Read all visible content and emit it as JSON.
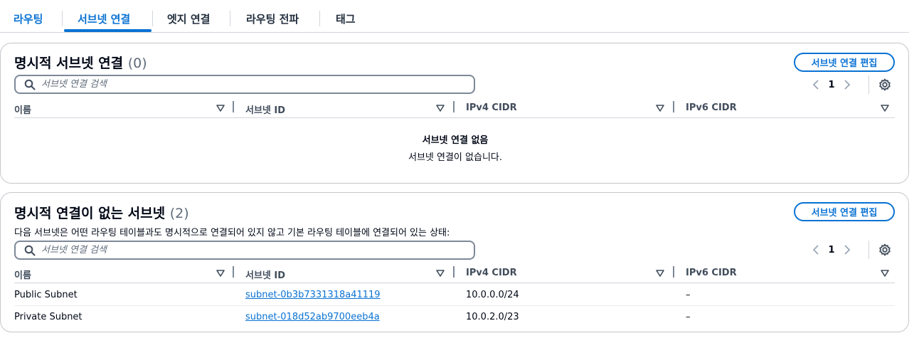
{
  "tabs": {
    "routing": "라우팅",
    "subnet_assoc": "서브넷 연결",
    "edge_assoc": "엣지 연결",
    "route_propagation": "라우팅 전파",
    "tags": "태그"
  },
  "explicit_section": {
    "title": "명시적 서브넷 연결",
    "count": "(0)",
    "edit_button": "서브넷 연결 편집",
    "search_placeholder": "서브넷 연결 검색",
    "page_number": "1",
    "columns": [
      "이름",
      "서브넷 ID",
      "IPv4 CIDR",
      "IPv6 CIDR"
    ],
    "empty_title": "서브넷 연결 없음",
    "empty_text": "서브넷 연결이 없습니다."
  },
  "implicit_section": {
    "title": "명시적 연결이 없는 서브넷",
    "count": "(2)",
    "description": "다음 서브넷은 어떤 라우팅 테이블과도 명시적으로 연결되어 있지 않고 기본 라우팅 테이블에 연결되어 있는 상태:",
    "edit_button": "서브넷 연결 편집",
    "search_placeholder": "서브넷 연결 검색",
    "page_number": "1",
    "columns": [
      "이름",
      "서브넷 ID",
      "IPv4 CIDR",
      "IPv6 CIDR"
    ],
    "rows": [
      {
        "name": "Public Subnet",
        "subnet_id": "subnet-0b3b7331318a41119",
        "ipv4": "10.0.0.0/24",
        "ipv6": "–"
      },
      {
        "name": "Private Subnet",
        "subnet_id": "subnet-018d52ab9700eeb4a",
        "ipv4": "10.0.2.0/23",
        "ipv6": "–"
      }
    ]
  },
  "colors": {
    "accent": "#0972d3",
    "text": "#000716",
    "border": "#c6c6cd"
  },
  "icons": [
    "search-icon",
    "chevron-left-icon",
    "chevron-right-icon",
    "gear-icon",
    "sort-down-icon"
  ]
}
